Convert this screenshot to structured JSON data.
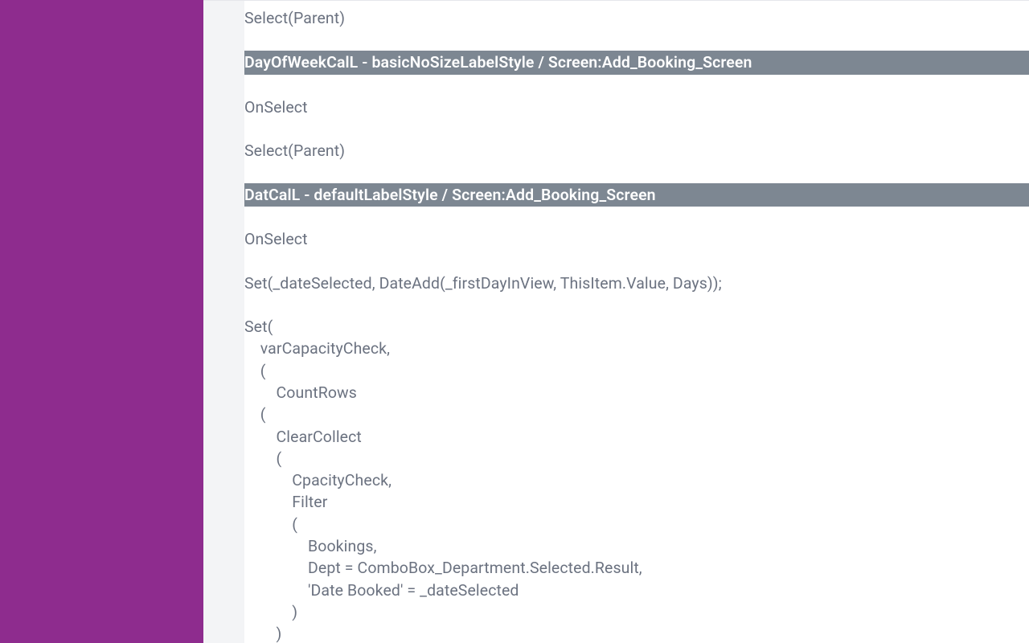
{
  "sections": [
    {
      "type": "code",
      "text": "Select(Parent)"
    },
    {
      "type": "spacer"
    },
    {
      "type": "header",
      "text": "DayOfWeekCalL - basicNoSizeLabelStyle / Screen:Add_Booking_Screen"
    },
    {
      "type": "spacer"
    },
    {
      "type": "code",
      "text": "OnSelect"
    },
    {
      "type": "spacer"
    },
    {
      "type": "code",
      "text": "Select(Parent)"
    },
    {
      "type": "spacer"
    },
    {
      "type": "header",
      "text": "DatCalL - defaultLabelStyle / Screen:Add_Booking_Screen"
    },
    {
      "type": "spacer"
    },
    {
      "type": "code",
      "text": "OnSelect"
    },
    {
      "type": "spacer"
    },
    {
      "type": "code",
      "text": "Set(_dateSelected, DateAdd(_firstDayInView, ThisItem.Value, Days));"
    },
    {
      "type": "spacer"
    },
    {
      "type": "code",
      "text": "Set("
    },
    {
      "type": "code",
      "text": "    varCapacityCheck,"
    },
    {
      "type": "code",
      "text": "    ("
    },
    {
      "type": "code",
      "text": "        CountRows"
    },
    {
      "type": "code",
      "text": "    ("
    },
    {
      "type": "code",
      "text": "        ClearCollect"
    },
    {
      "type": "code",
      "text": "        ("
    },
    {
      "type": "code",
      "text": "            CpacityCheck,"
    },
    {
      "type": "code",
      "text": "            Filter"
    },
    {
      "type": "code",
      "text": "            ("
    },
    {
      "type": "code",
      "text": "                Bookings,"
    },
    {
      "type": "code",
      "text": "                Dept = ComboBox_Department.Selected.Result,"
    },
    {
      "type": "code",
      "text": "                'Date Booked' = _dateSelected"
    },
    {
      "type": "code",
      "text": "            )"
    },
    {
      "type": "code",
      "text": "        )"
    }
  ]
}
